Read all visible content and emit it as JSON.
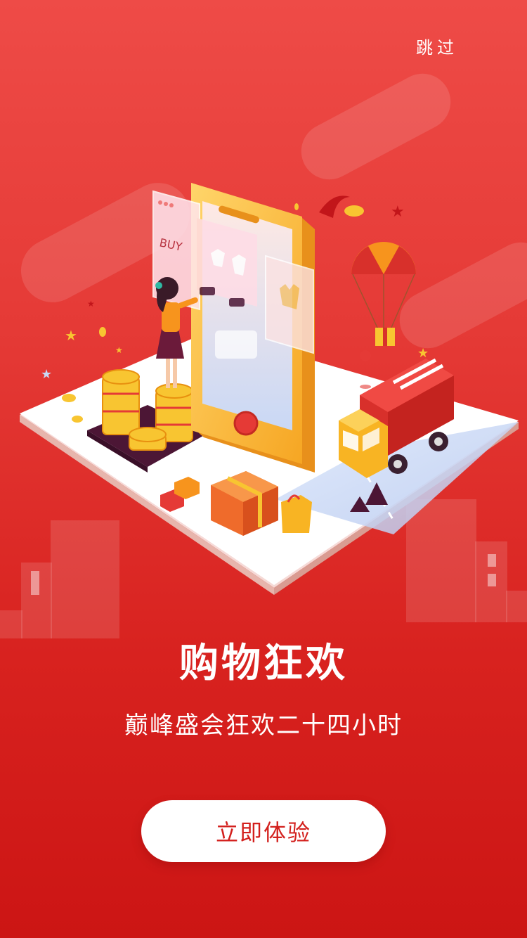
{
  "header": {
    "skip_label": "跳过"
  },
  "hero": {
    "buy_text": "BUY",
    "icons": [
      "phone-app-illustration",
      "shopper-woman",
      "gold-coins",
      "delivery-truck",
      "parachute-gift",
      "shopping-bag",
      "gift-boxes",
      "location-pin"
    ]
  },
  "content": {
    "title": "购物狂欢",
    "subtitle": "巅峰盛会狂欢二十四小时"
  },
  "cta": {
    "label": "立即体验"
  },
  "colors": {
    "bg_top": "#ee4b47",
    "bg_bottom": "#cc1514",
    "accent": "#d3201d",
    "gold": "#f8c531"
  }
}
